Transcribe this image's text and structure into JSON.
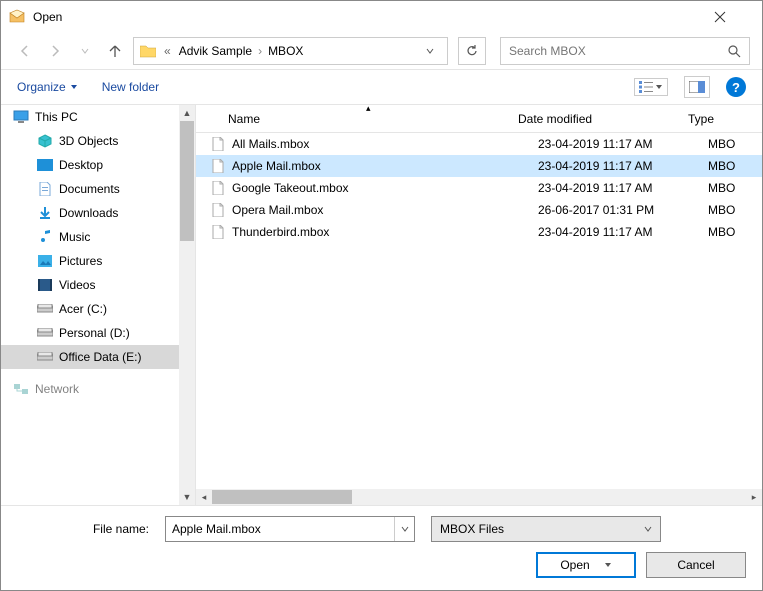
{
  "title": "Open",
  "breadcrumb": {
    "part1": "Advik Sample",
    "part2": "MBOX"
  },
  "search": {
    "placeholder": "Search MBOX"
  },
  "toolbar": {
    "organize": "Organize",
    "newfolder": "New folder"
  },
  "columns": {
    "name": "Name",
    "date": "Date modified",
    "type": "Type"
  },
  "tree": {
    "thispc": "This PC",
    "objects3d": "3D Objects",
    "desktop": "Desktop",
    "documents": "Documents",
    "downloads": "Downloads",
    "music": "Music",
    "pictures": "Pictures",
    "videos": "Videos",
    "acer": "Acer (C:)",
    "personal": "Personal (D:)",
    "office": "Office Data (E:)",
    "network": "Network"
  },
  "files": [
    {
      "name": "All Mails.mbox",
      "date": "23-04-2019 11:17 AM",
      "type": "MBO"
    },
    {
      "name": "Apple Mail.mbox",
      "date": "23-04-2019 11:17 AM",
      "type": "MBO"
    },
    {
      "name": "Google Takeout.mbox",
      "date": "23-04-2019 11:17 AM",
      "type": "MBO"
    },
    {
      "name": "Opera Mail.mbox",
      "date": "26-06-2017 01:31 PM",
      "type": "MBO"
    },
    {
      "name": "Thunderbird.mbox",
      "date": "23-04-2019 11:17 AM",
      "type": "MBO"
    }
  ],
  "filename": {
    "label": "File name:",
    "value": "Apple Mail.mbox"
  },
  "filetype": "MBOX Files",
  "buttons": {
    "open": "Open",
    "cancel": "Cancel"
  }
}
